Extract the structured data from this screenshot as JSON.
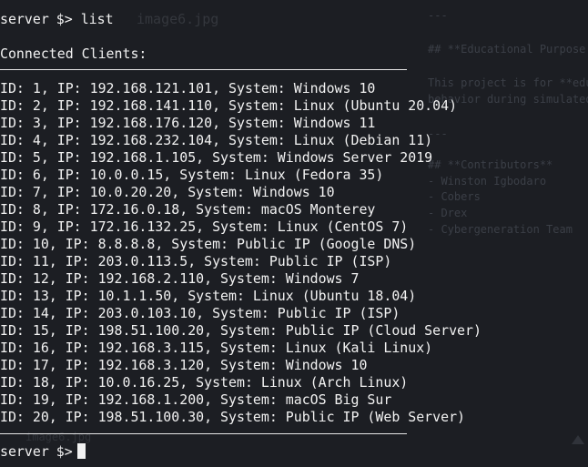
{
  "background": {
    "file_label": "image6.jpg",
    "file_label_bottom": "image6.jpg",
    "lines": [
      "---",
      "## **Educational Purpose",
      "This project is for **edu",
      "behavior during simulated",
      "---",
      "## **Contributors**",
      "- Winston Igbodaro",
      "- Cobers",
      "- Drex",
      "- Cybergeneration Team"
    ]
  },
  "terminal": {
    "prompt_host": "server",
    "prompt_symbol": "$>",
    "command": "list",
    "header": "Connected Clients:",
    "clients": [
      "ID: 1, IP: 192.168.121.101, System: Windows 10",
      "ID: 2, IP: 192.168.141.110, System: Linux (Ubuntu 20.04)",
      "ID: 3, IP: 192.168.176.120, System: Windows 11",
      "ID: 4, IP: 192.168.232.104, System: Linux (Debian 11)",
      "ID: 5, IP: 192.168.1.105, System: Windows Server 2019",
      "ID: 6, IP: 10.0.0.15, System: Linux (Fedora 35)",
      "ID: 7, IP: 10.0.20.20, System: Windows 10",
      "ID: 8, IP: 172.16.0.18, System: macOS Monterey",
      "ID: 9, IP: 172.16.132.25, System: Linux (CentOS 7)",
      "ID: 10, IP: 8.8.8.8, System: Public IP (Google DNS)",
      "ID: 11, IP: 203.0.113.5, System: Public IP (ISP)",
      "ID: 12, IP: 192.168.2.110, System: Windows 7",
      "ID: 13, IP: 10.1.1.50, System: Linux (Ubuntu 18.04)",
      "ID: 14, IP: 203.0.103.10, System: Public IP (ISP)",
      "ID: 15, IP: 198.51.100.20, System: Public IP (Cloud Server)",
      "ID: 16, IP: 192.168.3.115, System: Linux (Kali Linux)",
      "ID: 17, IP: 192.168.3.120, System: Windows 10",
      "ID: 18, IP: 10.0.16.25, System: Linux (Arch Linux)",
      "ID: 19, IP: 192.168.1.200, System: macOS Big Sur",
      "ID: 20, IP: 198.51.100.30, System: Public IP (Web Server)"
    ]
  },
  "colors": {
    "background": "#1c1e23",
    "text": "#f2f2f2",
    "ghost_text": "#3b3f47"
  }
}
